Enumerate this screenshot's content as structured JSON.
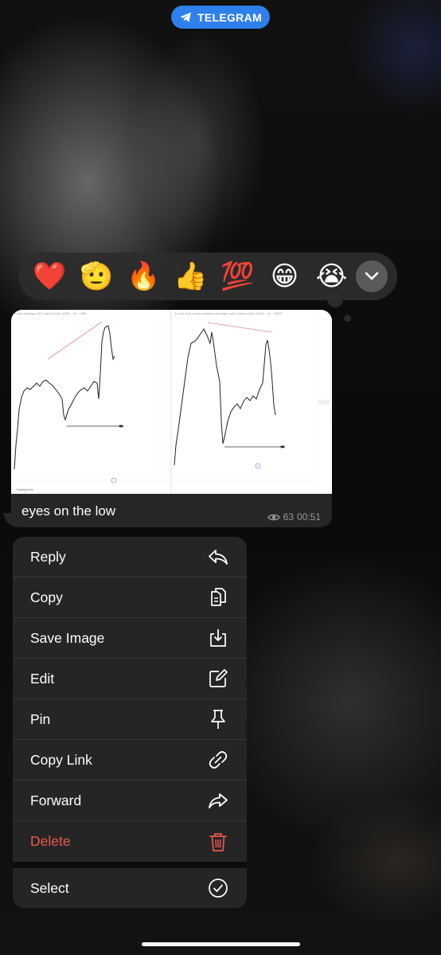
{
  "app_pill": {
    "label": "TELEGRAM",
    "icon": "telegram-plane-icon",
    "color": "#2f80ea"
  },
  "reactions": [
    {
      "name": "red-heart",
      "glyph": "❤️"
    },
    {
      "name": "saluting-face",
      "glyph": "🫡"
    },
    {
      "name": "fire",
      "glyph": "🔥"
    },
    {
      "name": "thumbs-up",
      "glyph": "👍"
    },
    {
      "name": "hundred-points",
      "glyph": "💯"
    },
    {
      "name": "grinning-face",
      "glyph": "😁"
    },
    {
      "name": "crying-face",
      "glyph": "😭"
    }
  ],
  "message": {
    "caption": "eyes on the low",
    "views": "63",
    "time": "00:51",
    "image_labels": {
      "left_title": "E-mini Nasdaq 100 Futures (Sep 2025) · 1H · CME",
      "right_title": "E-mini Dow Jones Industrial Average Index Futures (Sep 2025) · 1H · CBOT",
      "brand": "TradingView"
    }
  },
  "menu": {
    "items": [
      {
        "label": "Reply",
        "icon": "reply-icon"
      },
      {
        "label": "Copy",
        "icon": "copy-icon"
      },
      {
        "label": "Save Image",
        "icon": "download-icon"
      },
      {
        "label": "Edit",
        "icon": "edit-icon"
      },
      {
        "label": "Pin",
        "icon": "pin-icon"
      },
      {
        "label": "Copy Link",
        "icon": "link-icon"
      },
      {
        "label": "Forward",
        "icon": "forward-icon"
      },
      {
        "label": "Delete",
        "icon": "trash-icon"
      }
    ],
    "select": {
      "label": "Select",
      "icon": "checkmark-circle-icon"
    },
    "danger_color": "#e8584c"
  }
}
